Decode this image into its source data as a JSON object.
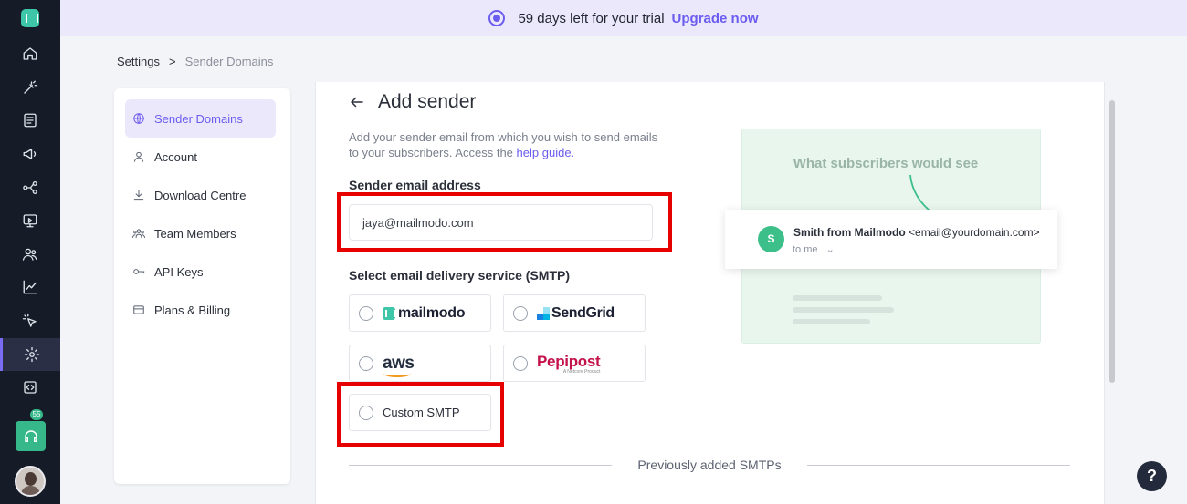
{
  "banner": {
    "trial_text": "59 days left for your trial",
    "upgrade_label": "Upgrade now",
    "icon": "moon-icon"
  },
  "rail": {
    "items": [
      {
        "icon": "home-icon"
      },
      {
        "icon": "magic-wand-icon"
      },
      {
        "icon": "template-icon"
      },
      {
        "icon": "megaphone-icon"
      },
      {
        "icon": "journey-icon"
      },
      {
        "icon": "screen-icon"
      },
      {
        "icon": "audience-icon"
      },
      {
        "icon": "analytics-icon"
      },
      {
        "icon": "click-icon"
      },
      {
        "icon": "settings-icon",
        "active": true
      },
      {
        "icon": "code-icon"
      }
    ],
    "support_badge": "55"
  },
  "breadcrumb": {
    "root": "Settings",
    "separator": ">",
    "current": "Sender Domains"
  },
  "menu": {
    "items": [
      {
        "label": "Sender Domains",
        "icon": "globe-icon",
        "active": true
      },
      {
        "label": "Account",
        "icon": "user-icon"
      },
      {
        "label": "Download Centre",
        "icon": "download-icon"
      },
      {
        "label": "Team Members",
        "icon": "team-icon"
      },
      {
        "label": "API Keys",
        "icon": "key-icon"
      },
      {
        "label": "Plans & Billing",
        "icon": "card-icon"
      }
    ]
  },
  "form": {
    "title": "Add sender",
    "description": "Add your sender email from which you wish to send emails to your subscribers. Access the",
    "help_link": "help guide.",
    "email_label": "Sender email address",
    "email_value": "jaya@mailmodo.com",
    "smtp_label": "Select email delivery service (SMTP)",
    "options": {
      "mailmodo": "mailmodo",
      "sendgrid": "SendGrid",
      "aws": "aws",
      "pepipost": "Pepipost",
      "pepipost_tag": "A Netcore Product",
      "custom": "Custom SMTP"
    },
    "previous_label": "Previously added SMTPs"
  },
  "preview": {
    "title": "What subscribers would see",
    "avatar_letter": "S",
    "sender_name": "Smith from Mailmodo",
    "sender_email": "<email@yourdomain.com>",
    "to_me": "to me",
    "bg_color": "#e8f6ee",
    "accent_color": "#3dbf8a"
  },
  "help_label": "?",
  "colors": {
    "brand": "#6b5cf0",
    "highlight": "#e60000",
    "rail": "#151b27"
  }
}
